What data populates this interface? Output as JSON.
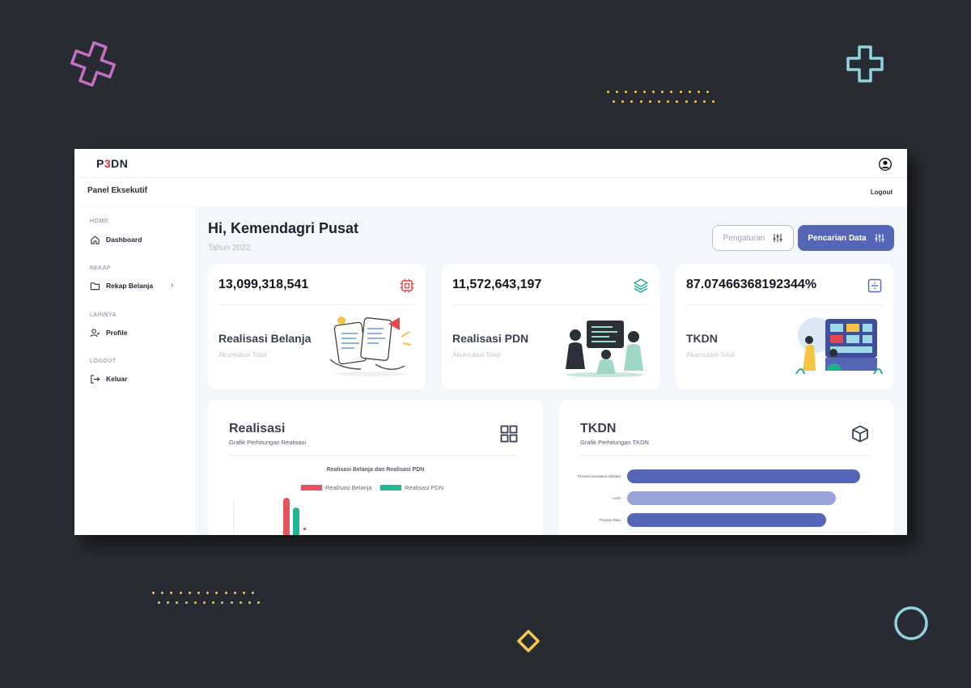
{
  "app": {
    "logo": {
      "prefix": "P",
      "accent": "3",
      "suffix": "DN"
    },
    "panel_title": "Panel Eksekutif",
    "logout_label": "Logout"
  },
  "sidebar": {
    "sections": [
      {
        "title": "HOME",
        "items": [
          {
            "label": "Dashboard",
            "icon": "home-icon"
          }
        ]
      },
      {
        "title": "REKAP",
        "items": [
          {
            "label": "Rekap Belanja",
            "icon": "folder-icon",
            "chevron": "›"
          }
        ]
      },
      {
        "title": "LAINNYA",
        "items": [
          {
            "label": "Profile",
            "icon": "user-check-icon"
          }
        ]
      },
      {
        "title": "LOGOUT",
        "items": [
          {
            "label": "Keluar",
            "icon": "exit-icon"
          }
        ]
      }
    ]
  },
  "main": {
    "greeting": "Hi, Kemendagri Pusat",
    "year_label": "Tahun 2022",
    "buttons": {
      "pengaturan": "Pengaturan",
      "pencarian": "Pencarian Data"
    },
    "cards": [
      {
        "value": "13,099,318,541",
        "title": "Realisasi Belanja",
        "subtitle": "Akumulasi Total",
        "icon": "cpu-icon",
        "icon_color": "#e5484d"
      },
      {
        "value": "11,572,643,197",
        "title": "Realisasi PDN",
        "subtitle": "Akumulasi Total",
        "icon": "layers-icon",
        "icon_color": "#1fb08a"
      },
      {
        "value": "87.07466368192344%",
        "title": "TKDN",
        "subtitle": "Akumulasi Total",
        "icon": "divide-icon",
        "icon_color": "#5466b5"
      }
    ]
  },
  "charts": {
    "realisasi": {
      "title": "Realisasi",
      "subtitle": "Grafik Perhitungan Realisasi",
      "icon": "grid-icon"
    },
    "tkdn": {
      "title": "TKDN",
      "subtitle": "Grafik Perhitungan TKDN",
      "icon": "box-icon"
    }
  },
  "chart_data": [
    {
      "type": "bar",
      "title": "Realisasi Belanja dan Realisasi PDN",
      "series": [
        {
          "name": "Realisasi Belanja",
          "color": "#e5535e",
          "values": [
            13099318541
          ]
        },
        {
          "name": "Realisasi PDN",
          "color": "#24b594",
          "values": [
            11572643197
          ]
        }
      ],
      "legend": "top-center",
      "note_visible": "chart partially clipped at bottom of view"
    },
    {
      "type": "bar",
      "orientation": "horizontal",
      "categories": [
        "Provinsi Sumatera Selatan",
        "Aceh",
        "Provinsi Riau"
      ],
      "values": [
        96,
        86,
        82
      ],
      "colors": [
        "#5466b5",
        "#9aa4d9",
        "#5466b5"
      ],
      "xlim": [
        0,
        100
      ]
    }
  ]
}
